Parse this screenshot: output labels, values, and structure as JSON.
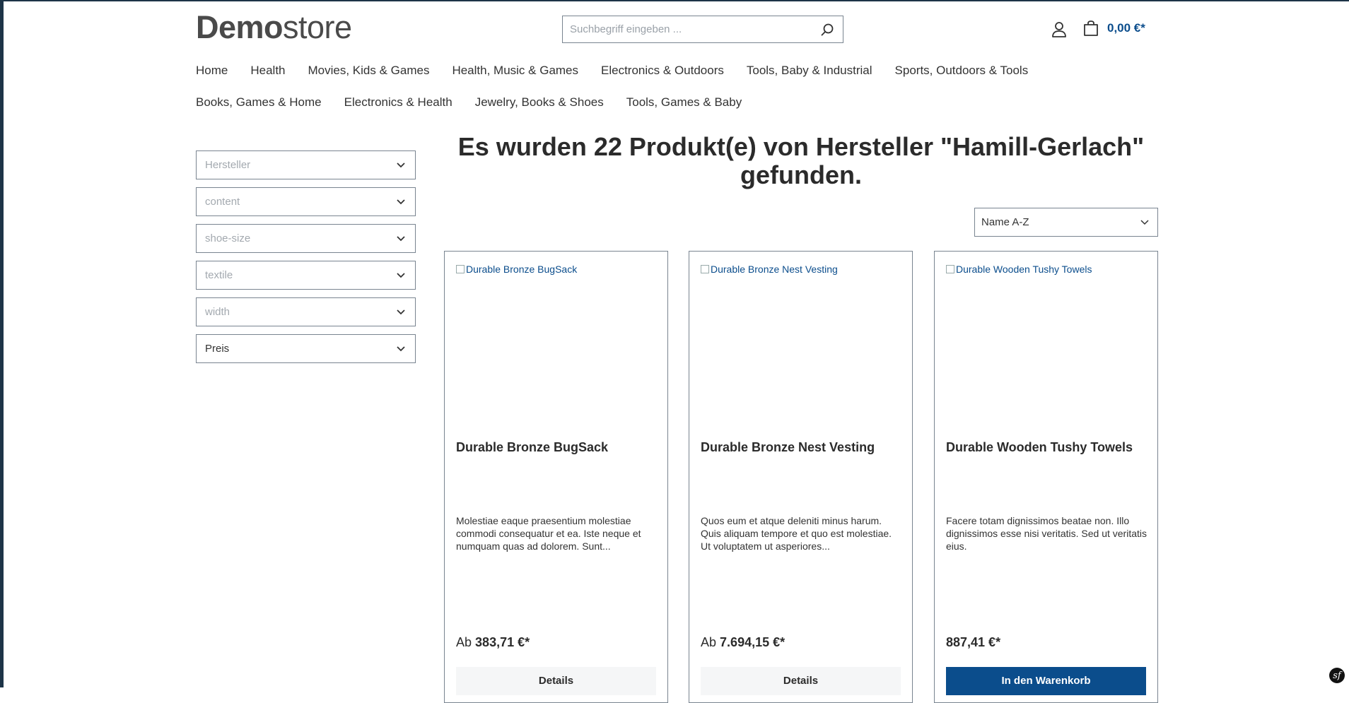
{
  "logo": {
    "bold": "Demo",
    "light": "store"
  },
  "search": {
    "placeholder": "Suchbegriff eingeben ...",
    "value": ""
  },
  "header": {
    "cart_total": "0,00 €*"
  },
  "icons": {
    "search": "search-icon",
    "account": "user-icon",
    "cart": "cart-icon",
    "chevron": "chevron-down-icon",
    "toolbar": "symfony-icon"
  },
  "nav": {
    "row1": [
      "Home",
      "Health",
      "Movies, Kids & Games",
      "Health, Music & Games",
      "Electronics & Outdoors",
      "Tools, Baby & Industrial",
      "Sports, Outdoors & Tools"
    ],
    "row2": [
      "Books, Games & Home",
      "Electronics & Health",
      "Jewelry, Books & Shoes",
      "Tools, Games & Baby"
    ]
  },
  "filters": [
    "Hersteller",
    "content",
    "shoe-size",
    "textile",
    "width",
    "Preis"
  ],
  "heading": "Es wurden 22 Produkt(e) von Hersteller \"Hamill-Gerlach\" gefunden.",
  "sort": {
    "selected": "Name A-Z"
  },
  "products": [
    {
      "image_alt": "Durable Bronze BugSack",
      "name": "Durable Bronze BugSack",
      "description": "Molestiae eaque praesentium molestiae commodi consequatur et ea. Iste neque et numquam quas ad dolorem. Sunt...",
      "price_prefix": "Ab",
      "price": "383,71 €*",
      "button": "Details"
    },
    {
      "image_alt": "Durable Bronze Nest Vesting",
      "name": "Durable Bronze Nest Vesting",
      "description": "Quos eum et atque deleniti minus harum. Quis aliquam tempore et quo est molestiae. Ut voluptatem ut asperiores...",
      "price_prefix": "Ab",
      "price": "7.694,15 €*",
      "button": "Details"
    },
    {
      "image_alt": "Durable Wooden Tushy Towels",
      "name": "Durable Wooden Tushy Towels",
      "description": "Facere totam dignissimos beatae non. Illo dignissimos esse nisi veritatis. Sed ut veritatis eius.",
      "price_prefix": "",
      "price": "887,41 €*",
      "button": "In den Warenkorb"
    }
  ],
  "colors": {
    "accent": "#0b4d8c",
    "border": "#798490",
    "frame": "#1d3447"
  }
}
